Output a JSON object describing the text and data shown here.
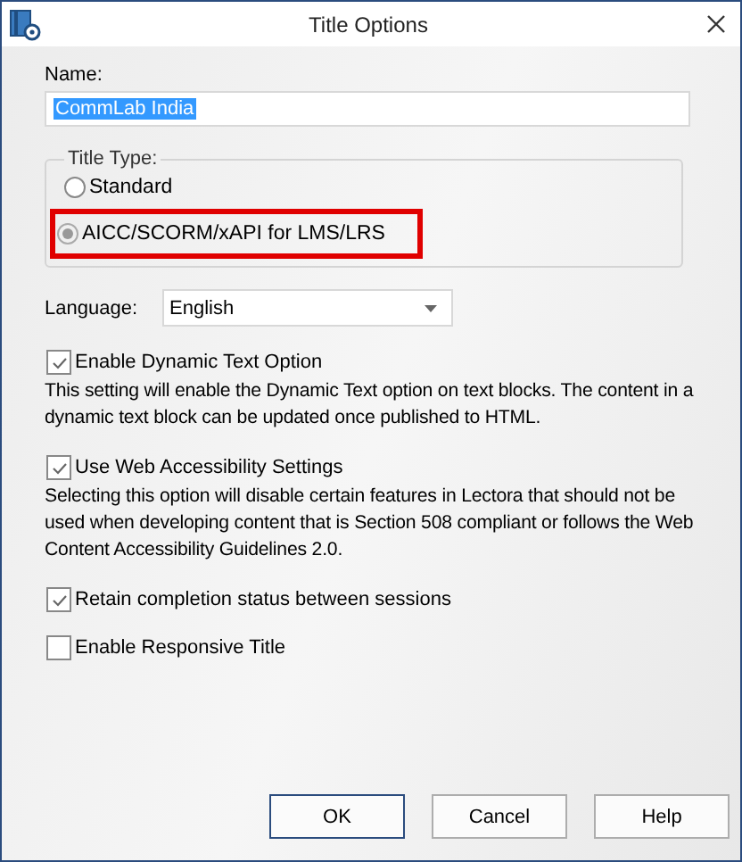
{
  "window": {
    "title": "Title Options"
  },
  "name": {
    "label": "Name:",
    "value": "CommLab India",
    "selected": true
  },
  "title_type": {
    "label": "Title Type:",
    "options": [
      {
        "label": "Standard",
        "selected": false,
        "disabled": false,
        "highlighted": false
      },
      {
        "label": "AICC/SCORM/xAPI for LMS/LRS",
        "selected": true,
        "disabled": true,
        "highlighted": true
      }
    ]
  },
  "language": {
    "label": "Language:",
    "value": "English"
  },
  "options": [
    {
      "label": "Enable Dynamic Text Option",
      "checked": true,
      "description": "This setting will enable the Dynamic Text option on text blocks. The content in a dynamic text block can be updated once published to HTML."
    },
    {
      "label": "Use Web Accessibility Settings",
      "checked": true,
      "description": "Selecting this option will disable certain features in Lectora that should not be used when developing content that is Section 508 compliant or follows the Web Content Accessibility Guidelines 2.0."
    },
    {
      "label": "Retain completion status between sessions",
      "checked": true
    },
    {
      "label": "Enable Responsive Title",
      "checked": false
    }
  ],
  "buttons": [
    {
      "label": "OK",
      "default": true
    },
    {
      "label": "Cancel",
      "default": false
    },
    {
      "label": "Help",
      "default": false
    }
  ]
}
